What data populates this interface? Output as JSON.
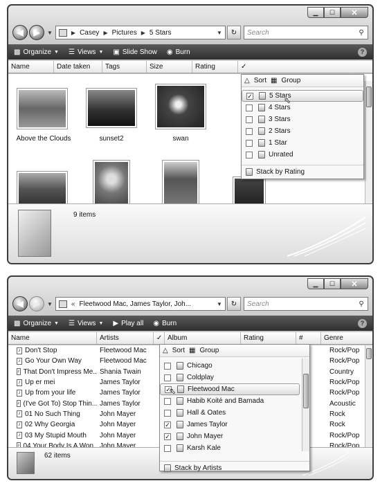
{
  "window1": {
    "caption": {
      "minimize": "▁",
      "maximize": "☐",
      "close": "✕"
    },
    "address": [
      "Casey",
      "Pictures",
      "5 Stars"
    ],
    "search_placeholder": "Search",
    "toolbar": {
      "organize": "Organize",
      "views": "Views",
      "slideshow": "Slide Show",
      "burn": "Burn"
    },
    "columns": [
      "Name",
      "Date taken",
      "Tags",
      "Size",
      "Rating"
    ],
    "column_check": "✓",
    "thumbnails": [
      {
        "label": "Above the Clouds"
      },
      {
        "label": "sunset2"
      },
      {
        "label": "swan"
      },
      {
        "label": ""
      },
      {
        "label": ""
      },
      {
        "label": ""
      },
      {
        "label": ""
      }
    ],
    "item_count": "9 items",
    "menu": {
      "sort": "Sort",
      "group": "Group",
      "items": [
        {
          "label": "5 Stars",
          "checked": true
        },
        {
          "label": "4 Stars",
          "checked": false
        },
        {
          "label": "3 Stars",
          "checked": false
        },
        {
          "label": "2 Stars",
          "checked": false
        },
        {
          "label": "1 Star",
          "checked": false
        },
        {
          "label": "Unrated",
          "checked": false
        }
      ],
      "stack_by": "Stack by Rating"
    }
  },
  "window2": {
    "caption": {
      "minimize": "▁",
      "maximize": "☐",
      "close": "✕"
    },
    "address_prefix": "«",
    "address": "Fleetwood Mac, James Taylor, Joh...",
    "search_placeholder": "Search",
    "toolbar": {
      "organize": "Organize",
      "views": "Views",
      "playall": "Play all",
      "burn": "Burn"
    },
    "columns": [
      "Name",
      "Artists",
      "Album",
      "Rating",
      "#",
      "Genre"
    ],
    "column_check": "✓",
    "rows": [
      {
        "name": "Don't Stop",
        "artist": "Fleetwood Mac",
        "genre": "Rock/Pop"
      },
      {
        "name": "Go Your Own Way",
        "artist": "Fleetwood Mac",
        "genre": "Rock/Pop"
      },
      {
        "name": "That Don't Impress Me...",
        "artist": "Shania Twain",
        "genre": "Country"
      },
      {
        "name": "Up er mei",
        "artist": "James Taylor",
        "genre": "Rock/Pop"
      },
      {
        "name": "Up from your life",
        "artist": "James Taylor",
        "genre": "Rock/Pop"
      },
      {
        "name": "(I've Got To) Stop Thin...",
        "artist": "James Taylor",
        "genre": "Acoustic"
      },
      {
        "name": "01 No Such Thing",
        "artist": "John Mayer",
        "genre": "Rock"
      },
      {
        "name": "02 Why Georgia",
        "artist": "John Mayer",
        "genre": "Rock"
      },
      {
        "name": "03 My Stupid Mouth",
        "artist": "John Mayer",
        "genre": "Rock/Pop"
      },
      {
        "name": "04 Your Body Is A Won...",
        "artist": "John Mayer",
        "genre": "Rock/Pop"
      }
    ],
    "item_count": "62 items",
    "menu": {
      "sort": "Sort",
      "group": "Group",
      "items": [
        {
          "label": "Chicago",
          "checked": false
        },
        {
          "label": "Coldplay",
          "checked": false
        },
        {
          "label": "Fleetwood Mac",
          "checked": true
        },
        {
          "label": "Habib Koité and Bamada",
          "checked": false
        },
        {
          "label": "Hall & Oates",
          "checked": false
        },
        {
          "label": "James Taylor",
          "checked": true
        },
        {
          "label": "John Mayer",
          "checked": true
        },
        {
          "label": "Karsh Kale",
          "checked": false
        }
      ],
      "stack_by": "Stack by Artists"
    }
  }
}
